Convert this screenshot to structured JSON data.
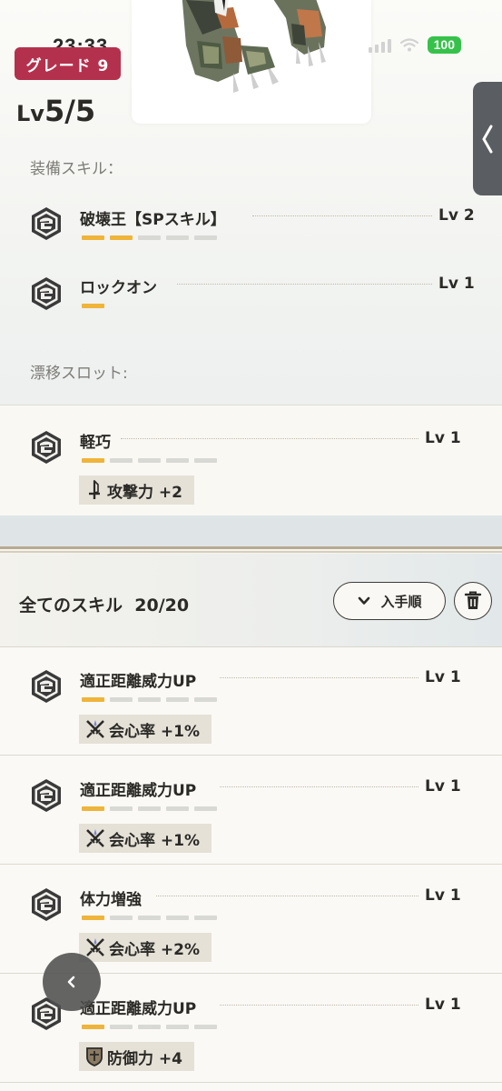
{
  "status_bar": {
    "time": "23:33",
    "battery": "100"
  },
  "header": {
    "grade": "グレード 9",
    "level_prefix": "Lv",
    "level_value": "5/5"
  },
  "equipped": {
    "label": "装備スキル：",
    "skills": [
      {
        "name": "破壊王【SPスキル】",
        "level": "Lv 2",
        "pips_filled": 2,
        "pips_total": 5
      },
      {
        "name": "ロックオン",
        "level": "Lv 1",
        "pips_filled": 1,
        "pips_total": 1
      }
    ]
  },
  "drift": {
    "label": "漂移スロット:",
    "skills": [
      {
        "name": "軽巧",
        "level": "Lv 1",
        "pips_filled": 1,
        "pips_total": 5,
        "effect": "攻撃力 +2",
        "effect_icon": "sword-icon"
      }
    ]
  },
  "all_skills": {
    "title": "全てのスキル",
    "count": "20/20",
    "sort_label": "入手順",
    "items": [
      {
        "name": "適正距離威力UP",
        "level": "Lv 1",
        "pips_filled": 1,
        "pips_total": 5,
        "effect": "会心率 +1%",
        "effect_icon": "crossed-blades-icon"
      },
      {
        "name": "適正距離威力UP",
        "level": "Lv 1",
        "pips_filled": 1,
        "pips_total": 5,
        "effect": "会心率 +1%",
        "effect_icon": "crossed-blades-icon"
      },
      {
        "name": "体力増強",
        "level": "Lv 1",
        "pips_filled": 1,
        "pips_total": 5,
        "effect": "会心率 +2%",
        "effect_icon": "crossed-blades-icon"
      },
      {
        "name": "適正距離威力UP",
        "level": "Lv 1",
        "pips_filled": 1,
        "pips_total": 5,
        "effect": "防御力 +4",
        "effect_icon": "shield-icon"
      }
    ]
  },
  "colors": {
    "grade_badge": "#b4314d",
    "pip_active": "#efb43a",
    "pip_inactive": "#d8d8d5",
    "battery": "#36c24a"
  }
}
